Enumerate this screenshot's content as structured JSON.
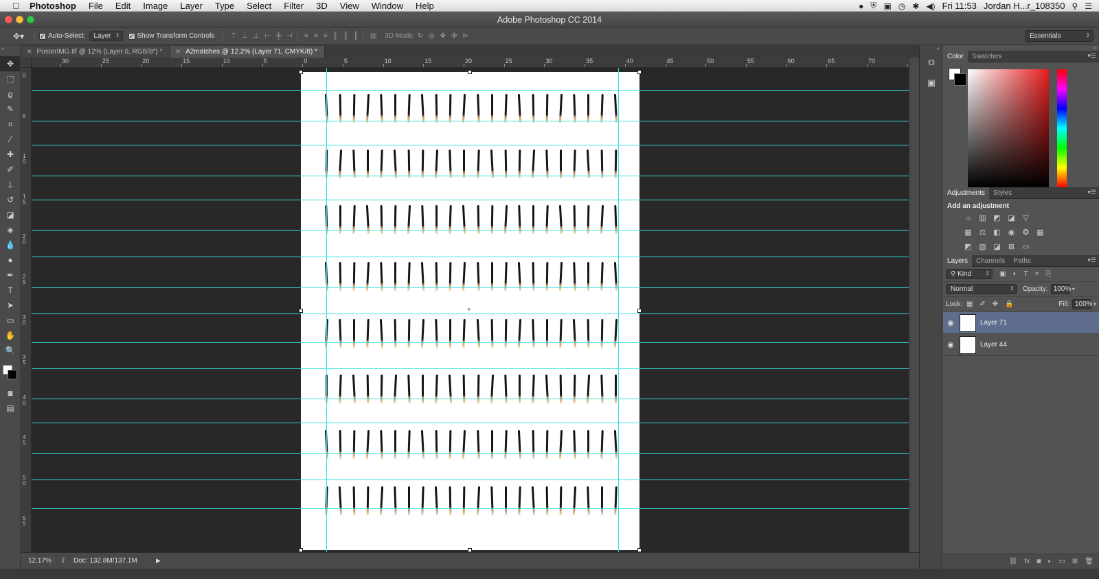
{
  "menubar": {
    "app": "Photoshop",
    "items": [
      "File",
      "Edit",
      "Image",
      "Layer",
      "Type",
      "Select",
      "Filter",
      "3D",
      "View",
      "Window",
      "Help"
    ],
    "clock": "Fri 11:53",
    "user": "Jordan H...r_108350"
  },
  "window": {
    "title": "Adobe Photoshop CC 2014"
  },
  "options": {
    "auto_select_label": "Auto-Select:",
    "auto_select_value": "Layer",
    "show_transform_label": "Show Transform Controls",
    "mode3d_label": "3D Mode:",
    "workspace": "Essentials"
  },
  "tabs": [
    {
      "label": "PosterIMG.tif @ 12% (Layer 0, RGB/8*) *"
    },
    {
      "label": "A2matches @ 12.2% (Layer 71, CMYK/8) *"
    }
  ],
  "rulers": {
    "top": [
      "30",
      "25",
      "20",
      "15",
      "10",
      "5",
      "0",
      "5",
      "10",
      "15",
      "20",
      "25",
      "30",
      "35",
      "40",
      "45",
      "50",
      "55",
      "60",
      "65",
      "70",
      "7"
    ],
    "left": [
      "0",
      "5",
      "10",
      "15",
      "20",
      "25",
      "30",
      "35",
      "40",
      "45",
      "50",
      "55"
    ]
  },
  "status": {
    "zoom": "12.17%",
    "doc": "Doc: 132.8M/137.1M"
  },
  "panels": {
    "color_tabs": [
      "Color",
      "Swatches"
    ],
    "adj_tabs": [
      "Adjustments",
      "Styles"
    ],
    "adj_heading": "Add an adjustment",
    "layer_tabs": [
      "Layers",
      "Channels",
      "Paths"
    ],
    "kind": "Kind",
    "blend_mode": "Normal",
    "opacity_label": "Opacity:",
    "opacity": "100%",
    "lock_label": "Lock:",
    "fill_label": "Fill:",
    "fill": "100%",
    "layers": [
      {
        "name": "Layer 71"
      },
      {
        "name": "Layer 44"
      }
    ]
  }
}
